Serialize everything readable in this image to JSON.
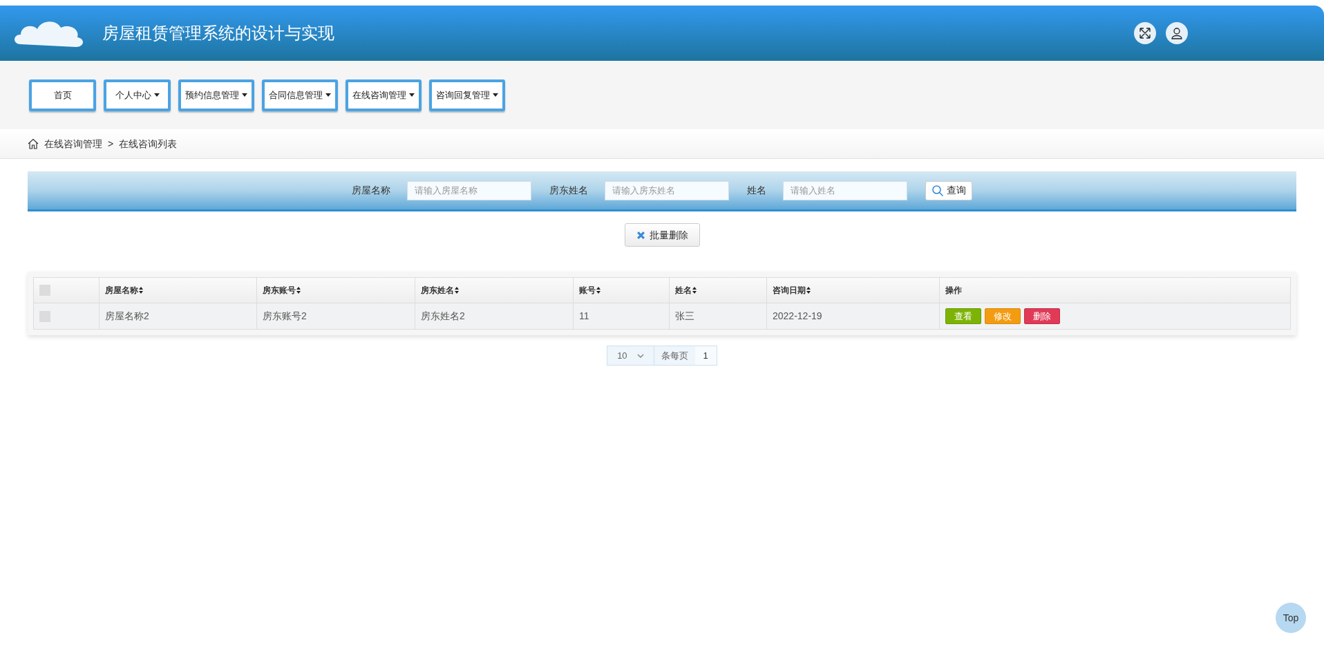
{
  "header": {
    "title": "房屋租赁管理系统的设计与实现"
  },
  "nav": [
    {
      "label": "首页",
      "dropdown": false
    },
    {
      "label": "个人中心",
      "dropdown": true
    },
    {
      "label": "预约信息管理",
      "dropdown": true
    },
    {
      "label": "合同信息管理",
      "dropdown": true
    },
    {
      "label": "在线咨询管理",
      "dropdown": true
    },
    {
      "label": "咨询回复管理",
      "dropdown": true
    }
  ],
  "breadcrumb": [
    "在线咨询管理",
    "在线咨询列表"
  ],
  "breadcrumb_separator": ">",
  "search": {
    "fields": [
      {
        "label": "房屋名称",
        "placeholder": "请输入房屋名称"
      },
      {
        "label": "房东姓名",
        "placeholder": "请输入房东姓名"
      },
      {
        "label": "姓名",
        "placeholder": "请输入姓名"
      }
    ],
    "button": "查询"
  },
  "batch_delete": "批量删除",
  "table": {
    "columns": [
      "房屋名称",
      "房东账号",
      "房东姓名",
      "账号",
      "姓名",
      "咨询日期",
      "操作"
    ],
    "header_checked": false,
    "rows": [
      {
        "checked": false,
        "cells": [
          "房屋名称2",
          "房东账号2",
          "房东姓名2",
          "11",
          "张三",
          "2022-12-19"
        ],
        "actions": [
          {
            "kind": "view",
            "label": "查看"
          },
          {
            "kind": "edit",
            "label": "修改"
          },
          {
            "kind": "delete",
            "label": "删除"
          }
        ]
      }
    ]
  },
  "pagination": {
    "page_size": "10",
    "page_size_label": "条每页",
    "pages": [
      {
        "label": "1",
        "selected": true
      }
    ]
  },
  "top_button": "Top"
}
